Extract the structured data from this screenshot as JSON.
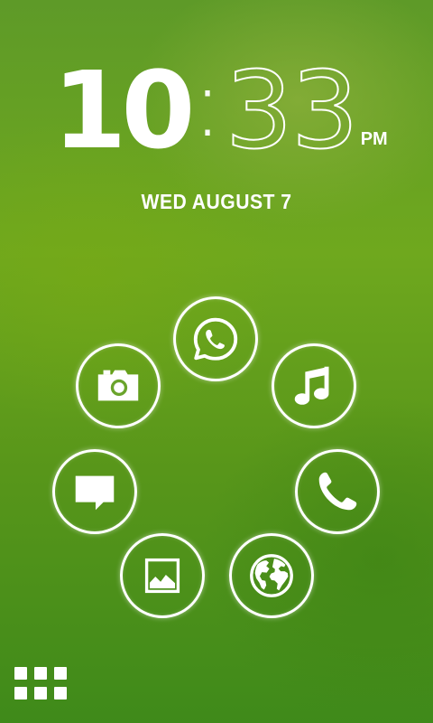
{
  "clock": {
    "hours": "10",
    "separator": ":",
    "minutes": "33",
    "ampm": "PM"
  },
  "date": "WED AUGUST 7",
  "apps": [
    {
      "name": "whatsapp",
      "icon": "whatsapp-icon"
    },
    {
      "name": "music",
      "icon": "music-note-icon"
    },
    {
      "name": "phone",
      "icon": "phone-icon"
    },
    {
      "name": "browser",
      "icon": "globe-icon"
    },
    {
      "name": "gallery",
      "icon": "picture-icon"
    },
    {
      "name": "messaging",
      "icon": "message-bubble-icon"
    },
    {
      "name": "camera",
      "icon": "camera-icon"
    }
  ],
  "drawer_icon": "app-drawer-grid-icon",
  "colors": {
    "foreground": "#ffffff",
    "background": "#5e9a28"
  }
}
